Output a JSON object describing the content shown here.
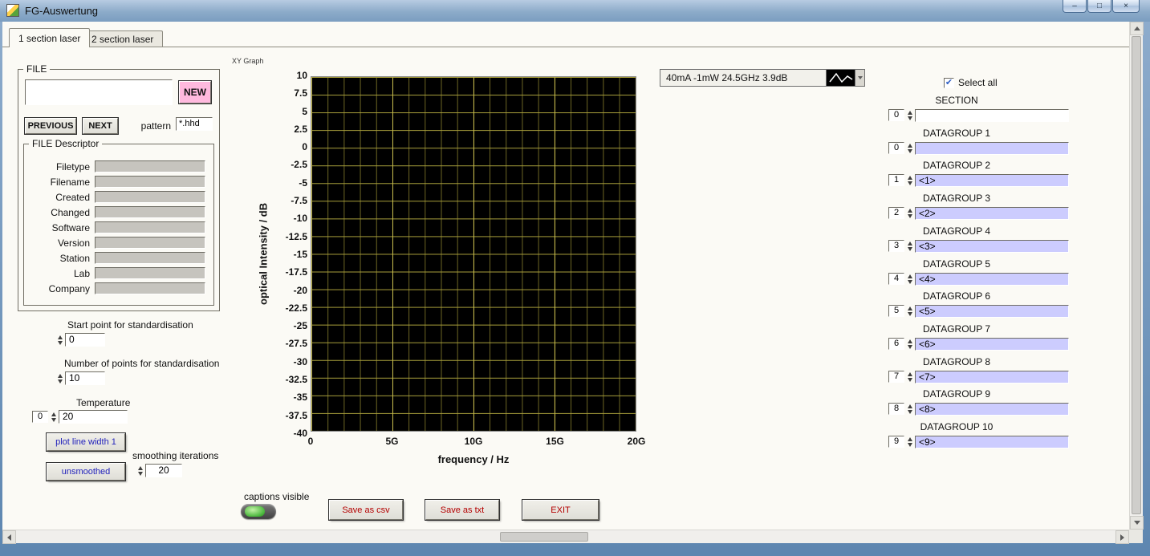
{
  "window": {
    "title": "FG-Auswertung",
    "controls": {
      "minimize": "–",
      "maximize": "□",
      "close": "×"
    }
  },
  "tabs": {
    "tab1": "1 section laser",
    "tab2": "2 section laser"
  },
  "file_panel": {
    "frame_label": "FILE",
    "path_value": "",
    "new_button": "NEW",
    "previous_button": "PREVIOUS",
    "next_button": "NEXT",
    "pattern_label": "pattern",
    "pattern_value": "*.hhd",
    "descriptor": {
      "frame_label": "FILE Descriptor",
      "rows": [
        {
          "label": "Filetype",
          "value": ""
        },
        {
          "label": "Filename",
          "value": ""
        },
        {
          "label": "Created",
          "value": ""
        },
        {
          "label": "Changed",
          "value": ""
        },
        {
          "label": "Software",
          "value": ""
        },
        {
          "label": "Version",
          "value": ""
        },
        {
          "label": "Station",
          "value": ""
        },
        {
          "label": "Lab",
          "value": ""
        },
        {
          "label": "Company",
          "value": ""
        }
      ]
    }
  },
  "standardisation": {
    "start_label": "Start point for standardisation",
    "start_value": "0",
    "points_label": "Number of points for standardisation",
    "points_value": "10",
    "temperature_label": "Temperature",
    "temperature_index": "0",
    "temperature_value": "20",
    "plot_line_width_button": "plot line width 1",
    "smoothing_button": "unsmoothed",
    "smoothing_label": "smoothing iterations",
    "smoothing_value": "20"
  },
  "graph": {
    "name": "XY Graph",
    "legend_text": "40mA  -1mW 24.5GHz 3.9dB",
    "y_axis_label": "optical Intensity / dB",
    "x_axis_label": "frequency / Hz",
    "y_ticks": [
      "10",
      "7.5",
      "5",
      "2.5",
      "0",
      "-2.5",
      "-5",
      "-7.5",
      "-10",
      "-12.5",
      "-15",
      "-17.5",
      "-20",
      "-22.5",
      "-25",
      "-27.5",
      "-30",
      "-32.5",
      "-35",
      "-37.5",
      "-40"
    ],
    "x_ticks": [
      "0",
      "5G",
      "10G",
      "15G",
      "20G"
    ],
    "y_range": [
      -40,
      10
    ],
    "x_range_hz": [
      0,
      20000000000
    ]
  },
  "right_panel": {
    "select_all_label": "Select all",
    "select_all_checked": true,
    "groups": [
      {
        "label": "SECTION",
        "index": "0",
        "value": ""
      },
      {
        "label": "DATAGROUP 1",
        "index": "0",
        "value": ""
      },
      {
        "label": "DATAGROUP 2",
        "index": "1",
        "value": "<1>"
      },
      {
        "label": "DATAGROUP 3",
        "index": "2",
        "value": "<2>"
      },
      {
        "label": "DATAGROUP 4",
        "index": "3",
        "value": "<3>"
      },
      {
        "label": "DATAGROUP 5",
        "index": "4",
        "value": "<4>"
      },
      {
        "label": "DATAGROUP 6",
        "index": "5",
        "value": "<5>"
      },
      {
        "label": "DATAGROUP 7",
        "index": "6",
        "value": "<6>"
      },
      {
        "label": "DATAGROUP 8",
        "index": "7",
        "value": "<7>"
      },
      {
        "label": "DATAGROUP 9",
        "index": "8",
        "value": "<8>"
      },
      {
        "label": "DATAGROUP 10",
        "index": "9",
        "value": "<9>"
      }
    ]
  },
  "footer": {
    "captions_label": "captions visible",
    "save_csv_button": "Save as csv",
    "save_txt_button": "Save as txt",
    "exit_button": "EXIT"
  },
  "icons": {
    "check": "✔"
  },
  "colors": {
    "button_blue_text": "#2222bb",
    "button_red_text": "#b40000",
    "datagroup_field": "#ccccfe",
    "new_button_pink": "#ffb9de",
    "grid_major": "#c8bd4e",
    "grid_minor": "#6e6724",
    "led_green": "#49b63b"
  }
}
